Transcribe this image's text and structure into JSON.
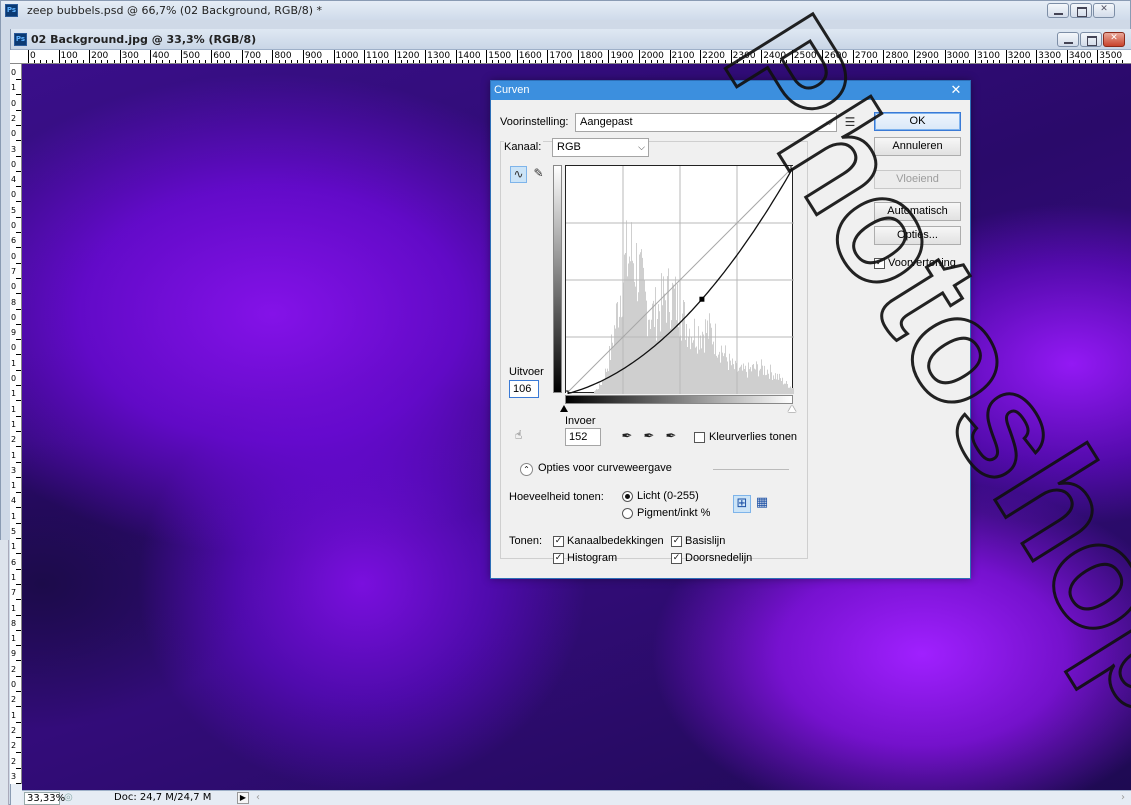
{
  "outer_window": {
    "badge": "Ps",
    "title": "zeep bubbels.psd @ 66,7% (02 Background, RGB/8) *"
  },
  "inner_window": {
    "badge": "Ps",
    "title": "02 Background.jpg @ 33,3% (RGB/8)"
  },
  "ruler_top": {
    "labels": [
      "0",
      "100",
      "200",
      "300",
      "400",
      "500",
      "600",
      "700",
      "800",
      "900",
      "1000",
      "1100",
      "1200",
      "1300",
      "1400",
      "1500",
      "1600",
      "1700",
      "1800",
      "1900",
      "2000",
      "2100",
      "2200",
      "2300",
      "2400",
      "2500",
      "2600",
      "2700",
      "2800",
      "2900",
      "3000",
      "3100",
      "3200",
      "3300",
      "3400",
      "3500"
    ]
  },
  "ruler_left": {
    "labels": [
      "0",
      "1",
      "0",
      "2",
      "0",
      "3",
      "0",
      "4",
      "0",
      "5",
      "0",
      "6",
      "0",
      "7",
      "0",
      "8",
      "0",
      "9",
      "0",
      "1",
      "0",
      "1",
      "1",
      "1",
      "2",
      "1",
      "3",
      "1",
      "4",
      "1",
      "5",
      "1",
      "6",
      "1",
      "7",
      "1",
      "8",
      "1",
      "9",
      "2",
      "0",
      "2",
      "1",
      "2",
      "2",
      "2",
      "3"
    ]
  },
  "statusbar": {
    "zoom": "33,33%",
    "doc_info": "Doc: 24,7 M/24,7 M"
  },
  "dialog": {
    "title": "Curven",
    "preset_label": "Voorinstelling:",
    "preset_value": "Aangepast",
    "channel_label": "Kanaal:",
    "channel_value": "RGB",
    "buttons": {
      "ok": "OK",
      "cancel": "Annuleren",
      "smooth": "Vloeiend",
      "auto": "Automatisch",
      "options": "Opties..."
    },
    "preview_label": "Voorvertoning",
    "preview_checked": true,
    "output_label": "Uitvoer",
    "output_value": "106",
    "input_label": "Invoer",
    "input_value": "152",
    "clipping_label": "Kleurverlies tonen",
    "display_options_label": "Opties voor curveweergave",
    "amount_label": "Hoeveelheid tonen:",
    "light_label": "Licht (0-255)",
    "pigment_label": "Pigment/inkt %",
    "show_label": "Tonen:",
    "show_options": {
      "channel_overlays": "Kanaalbedekkingen",
      "baseline": "Basislijn",
      "histogram": "Histogram",
      "intersection": "Doorsnedelijn"
    },
    "curve": {
      "point": {
        "input": 152,
        "output": 106
      },
      "range": [
        0,
        255
      ]
    }
  },
  "watermark_text": "Photoshop"
}
